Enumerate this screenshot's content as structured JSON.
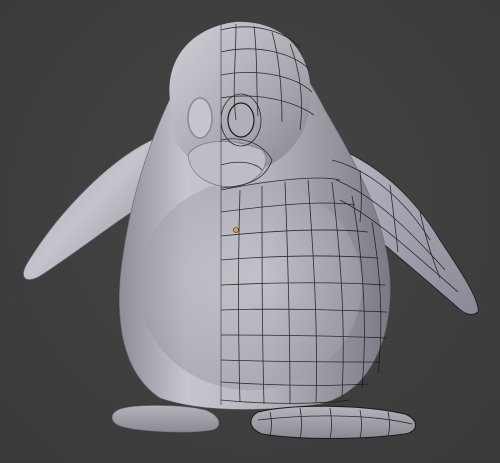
{
  "viewport": {
    "background_color": "#3d3d3d",
    "content": "penguin-model",
    "left_half_shading": "smooth",
    "right_half_shading": "wireframe-mirror"
  },
  "colors": {
    "mesh_body": "#b9b9c2",
    "wire": "#111111",
    "origin_point": "#e8a23a"
  },
  "icons": [
    "penguin-mesh-icon",
    "origin-point-icon"
  ]
}
